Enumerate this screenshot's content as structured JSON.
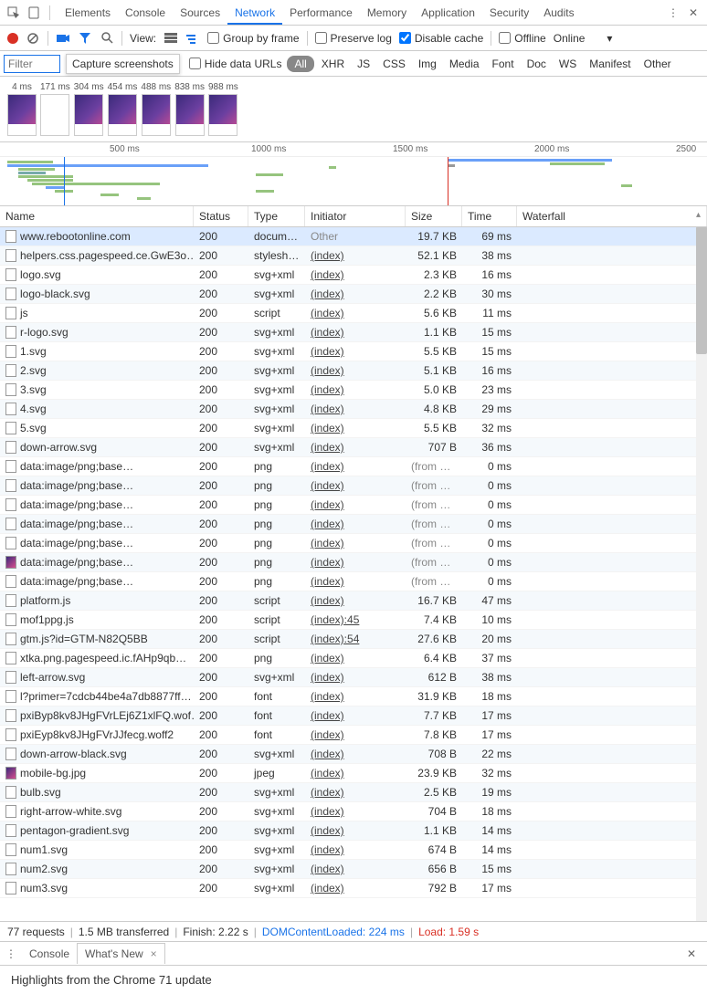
{
  "tabs": [
    "Elements",
    "Console",
    "Sources",
    "Network",
    "Performance",
    "Memory",
    "Application",
    "Security",
    "Audits"
  ],
  "activeTab": "Network",
  "toolbar": {
    "view": "View:",
    "groupByFrame": "Group by frame",
    "preserveLog": "Preserve log",
    "disableCache": "Disable cache",
    "offline": "Offline",
    "throttle": "Online"
  },
  "filter": {
    "placeholder": "Filter",
    "tooltip": "Capture screenshots",
    "hideDataUrls": "Hide data URLs",
    "types": [
      "All",
      "XHR",
      "JS",
      "CSS",
      "Img",
      "Media",
      "Font",
      "Doc",
      "WS",
      "Manifest",
      "Other"
    ]
  },
  "thumbs": [
    "4 ms",
    "171 ms",
    "304 ms",
    "454 ms",
    "488 ms",
    "838 ms",
    "988 ms"
  ],
  "timeline": {
    "ticks": [
      "500 ms",
      "1000 ms",
      "1500 ms",
      "2000 ms",
      "2500"
    ]
  },
  "headers": {
    "name": "Name",
    "status": "Status",
    "type": "Type",
    "initiator": "Initiator",
    "size": "Size",
    "time": "Time",
    "waterfall": "Waterfall"
  },
  "rows": [
    {
      "n": "www.rebootonline.com",
      "s": "200",
      "t": "document",
      "i": "Other",
      "iNoUl": true,
      "sz": "19.7 KB",
      "tm": "69 ms",
      "sel": true
    },
    {
      "n": "helpers.css.pagespeed.ce.GwE3o…",
      "s": "200",
      "t": "stylesheet",
      "i": "(index)",
      "sz": "52.1 KB",
      "tm": "38 ms"
    },
    {
      "n": "logo.svg",
      "s": "200",
      "t": "svg+xml",
      "i": "(index)",
      "sz": "2.3 KB",
      "tm": "16 ms"
    },
    {
      "n": "logo-black.svg",
      "s": "200",
      "t": "svg+xml",
      "i": "(index)",
      "sz": "2.2 KB",
      "tm": "30 ms"
    },
    {
      "n": "js",
      "s": "200",
      "t": "script",
      "i": "(index)",
      "sz": "5.6 KB",
      "tm": "11 ms"
    },
    {
      "n": "r-logo.svg",
      "s": "200",
      "t": "svg+xml",
      "i": "(index)",
      "sz": "1.1 KB",
      "tm": "15 ms"
    },
    {
      "n": "1.svg",
      "s": "200",
      "t": "svg+xml",
      "i": "(index)",
      "sz": "5.5 KB",
      "tm": "15 ms"
    },
    {
      "n": "2.svg",
      "s": "200",
      "t": "svg+xml",
      "i": "(index)",
      "sz": "5.1 KB",
      "tm": "16 ms"
    },
    {
      "n": "3.svg",
      "s": "200",
      "t": "svg+xml",
      "i": "(index)",
      "sz": "5.0 KB",
      "tm": "23 ms"
    },
    {
      "n": "4.svg",
      "s": "200",
      "t": "svg+xml",
      "i": "(index)",
      "sz": "4.8 KB",
      "tm": "29 ms"
    },
    {
      "n": "5.svg",
      "s": "200",
      "t": "svg+xml",
      "i": "(index)",
      "sz": "5.5 KB",
      "tm": "32 ms"
    },
    {
      "n": "down-arrow.svg",
      "s": "200",
      "t": "svg+xml",
      "i": "(index)",
      "sz": "707 B",
      "tm": "36 ms"
    },
    {
      "n": "data:image/png;base…",
      "s": "200",
      "t": "png",
      "i": "(index)",
      "sz": "(from m…",
      "tm": "0 ms",
      "mem": true
    },
    {
      "n": "data:image/png;base…",
      "s": "200",
      "t": "png",
      "i": "(index)",
      "sz": "(from m…",
      "tm": "0 ms",
      "mem": true
    },
    {
      "n": "data:image/png;base…",
      "s": "200",
      "t": "png",
      "i": "(index)",
      "sz": "(from m…",
      "tm": "0 ms",
      "mem": true
    },
    {
      "n": "data:image/png;base…",
      "s": "200",
      "t": "png",
      "i": "(index)",
      "sz": "(from m…",
      "tm": "0 ms",
      "mem": true
    },
    {
      "n": "data:image/png;base…",
      "s": "200",
      "t": "png",
      "i": "(index)",
      "sz": "(from m…",
      "tm": "0 ms",
      "mem": true
    },
    {
      "n": "data:image/png;base…",
      "s": "200",
      "t": "png",
      "i": "(index)",
      "sz": "(from m…",
      "tm": "0 ms",
      "mem": true,
      "img": true
    },
    {
      "n": "data:image/png;base…",
      "s": "200",
      "t": "png",
      "i": "(index)",
      "sz": "(from m…",
      "tm": "0 ms",
      "mem": true
    },
    {
      "n": "platform.js",
      "s": "200",
      "t": "script",
      "i": "(index)",
      "sz": "16.7 KB",
      "tm": "47 ms"
    },
    {
      "n": "mof1ppg.js",
      "s": "200",
      "t": "script",
      "i": "(index):45",
      "sz": "7.4 KB",
      "tm": "10 ms"
    },
    {
      "n": "gtm.js?id=GTM-N82Q5BB",
      "s": "200",
      "t": "script",
      "i": "(index):54",
      "sz": "27.6 KB",
      "tm": "20 ms"
    },
    {
      "n": "xtka.png.pagespeed.ic.fAHp9qb…",
      "s": "200",
      "t": "png",
      "i": "(index)",
      "sz": "6.4 KB",
      "tm": "37 ms"
    },
    {
      "n": "left-arrow.svg",
      "s": "200",
      "t": "svg+xml",
      "i": "(index)",
      "sz": "612 B",
      "tm": "38 ms"
    },
    {
      "n": "l?primer=7cdcb44be4a7db8877ff…",
      "s": "200",
      "t": "font",
      "i": "(index)",
      "sz": "31.9 KB",
      "tm": "18 ms"
    },
    {
      "n": "pxiByp8kv8JHgFVrLEj6Z1xlFQ.wof…",
      "s": "200",
      "t": "font",
      "i": "(index)",
      "sz": "7.7 KB",
      "tm": "17 ms"
    },
    {
      "n": "pxiEyp8kv8JHgFVrJJfecg.woff2",
      "s": "200",
      "t": "font",
      "i": "(index)",
      "sz": "7.8 KB",
      "tm": "17 ms"
    },
    {
      "n": "down-arrow-black.svg",
      "s": "200",
      "t": "svg+xml",
      "i": "(index)",
      "sz": "708 B",
      "tm": "22 ms"
    },
    {
      "n": "mobile-bg.jpg",
      "s": "200",
      "t": "jpeg",
      "i": "(index)",
      "sz": "23.9 KB",
      "tm": "32 ms",
      "img": true
    },
    {
      "n": "bulb.svg",
      "s": "200",
      "t": "svg+xml",
      "i": "(index)",
      "sz": "2.5 KB",
      "tm": "19 ms"
    },
    {
      "n": "right-arrow-white.svg",
      "s": "200",
      "t": "svg+xml",
      "i": "(index)",
      "sz": "704 B",
      "tm": "18 ms"
    },
    {
      "n": "pentagon-gradient.svg",
      "s": "200",
      "t": "svg+xml",
      "i": "(index)",
      "sz": "1.1 KB",
      "tm": "14 ms"
    },
    {
      "n": "num1.svg",
      "s": "200",
      "t": "svg+xml",
      "i": "(index)",
      "sz": "674 B",
      "tm": "14 ms"
    },
    {
      "n": "num2.svg",
      "s": "200",
      "t": "svg+xml",
      "i": "(index)",
      "sz": "656 B",
      "tm": "15 ms"
    },
    {
      "n": "num3.svg",
      "s": "200",
      "t": "svg+xml",
      "i": "(index)",
      "sz": "792 B",
      "tm": "17 ms"
    }
  ],
  "status": {
    "requests": "77 requests",
    "transferred": "1.5 MB transferred",
    "finish": "Finish: 2.22 s",
    "dcl": "DOMContentLoaded: 224 ms",
    "load": "Load: 1.59 s"
  },
  "drawer": {
    "tabs": [
      "Console",
      "What's New"
    ],
    "body": "Highlights from the Chrome 71 update"
  }
}
